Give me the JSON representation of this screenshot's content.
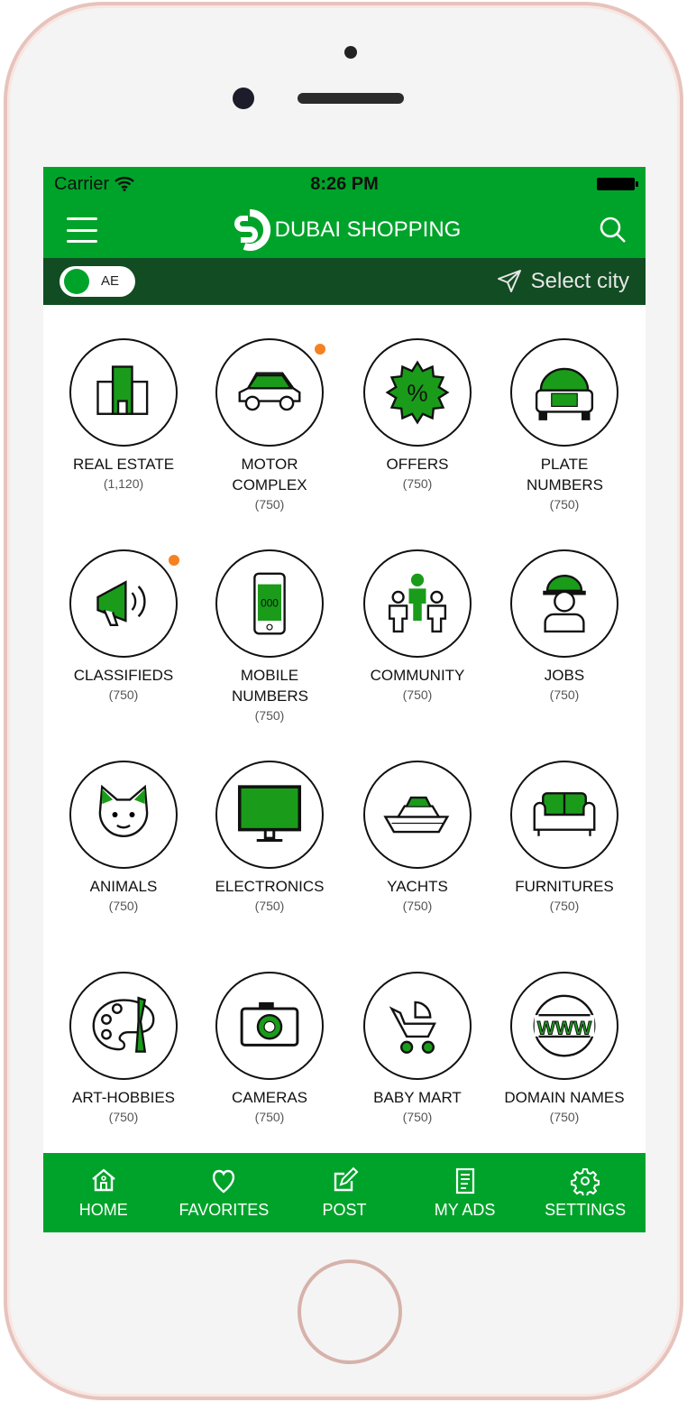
{
  "status": {
    "carrier": "Carrier",
    "time": "8:26 PM"
  },
  "header": {
    "title": "DUBAI SHOPPING",
    "menu_icon": "hamburger-icon",
    "search_icon": "search-icon"
  },
  "citybar": {
    "country": "AE",
    "city_label": "Select city"
  },
  "colors": {
    "primary": "#00a32a",
    "dark": "#114c22",
    "badge": "#f58220"
  },
  "categories": [
    {
      "name": "REAL ESTATE",
      "count": "(1,120)",
      "icon": "building-icon"
    },
    {
      "name": "MOTOR COMPLEX",
      "count": "(750)",
      "icon": "car-icon",
      "badge": true
    },
    {
      "name": "OFFERS",
      "count": "(750)",
      "icon": "percent-badge-icon"
    },
    {
      "name": "PLATE NUMBERS",
      "count": "(750)",
      "icon": "taxi-plate-icon"
    },
    {
      "name": "CLASSIFIEDS",
      "count": "(750)",
      "icon": "megaphone-icon",
      "badge": true
    },
    {
      "name": "MOBILE NUMBERS",
      "count": "(750)",
      "icon": "mobile-phone-icon"
    },
    {
      "name": "COMMUNITY",
      "count": "(750)",
      "icon": "people-icon"
    },
    {
      "name": "JOBS",
      "count": "(750)",
      "icon": "worker-icon"
    },
    {
      "name": "ANIMALS",
      "count": "(750)",
      "icon": "cat-icon"
    },
    {
      "name": "ELECTRONICS",
      "count": "(750)",
      "icon": "monitor-icon"
    },
    {
      "name": "YACHTS",
      "count": "(750)",
      "icon": "yacht-icon"
    },
    {
      "name": "FURNITURES",
      "count": "(750)",
      "icon": "sofa-icon"
    },
    {
      "name": "ART-HOBBIES",
      "count": "(750)",
      "icon": "palette-icon"
    },
    {
      "name": "CAMERAS",
      "count": "(750)",
      "icon": "camera-icon"
    },
    {
      "name": "BABY MART",
      "count": "(750)",
      "icon": "stroller-icon"
    },
    {
      "name": "DOMAIN NAMES",
      "count": "(750)",
      "icon": "www-icon"
    }
  ],
  "tabs": [
    {
      "label": "HOME",
      "icon": "home-icon"
    },
    {
      "label": "FAVORITES",
      "icon": "heart-icon"
    },
    {
      "label": "POST",
      "icon": "edit-icon"
    },
    {
      "label": "MY ADS",
      "icon": "document-icon"
    },
    {
      "label": "SETTINGS",
      "icon": "gear-icon"
    }
  ]
}
